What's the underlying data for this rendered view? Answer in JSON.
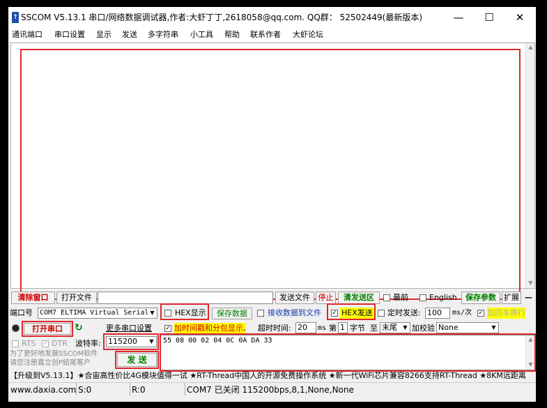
{
  "app": {
    "title": "SSCOM V5.13.1 串口/网络数据调试器,作者:大虾丁丁,2618058@qq.com. QQ群：  52502449(最新版本)",
    "icon": "app-icon",
    "minimize": "—",
    "maximize": "☐",
    "close": "✕"
  },
  "menu": [
    "通讯端口",
    "串口设置",
    "显示",
    "发送",
    "多字符串",
    "小工具",
    "帮助",
    "联系作者",
    "大虾论坛"
  ],
  "receive_area": {
    "content": ""
  },
  "toolbar1": {
    "clear_window": "清除窗口",
    "open_file": "打开文件",
    "file_path": "",
    "send_file": "发送文件",
    "stop": "停止",
    "clear_send_area": "清发送区",
    "topmost_label": "最前",
    "english_label": "English",
    "save_params": "保存参数",
    "expand": "扩展",
    "collapse": "—"
  },
  "port": {
    "label": "端口号",
    "value": "COM7 ELTIMA Virtual Serial",
    "hex_display_label": "HEX显示",
    "save_data": "保存数据",
    "recv_to_file_label": "接收数据到文件",
    "hex_send_label": "HEX发送",
    "timed_send_label": "定时发送:",
    "timed_send_value": "100",
    "timed_send_unit": "ms/次",
    "add_crlf_label": "加回车换行",
    "open_port": "打开串口",
    "more_settings": "更多串口设置",
    "timestamp_label": "加时间戳和分包显示,",
    "timeout_label": "超时时间:",
    "timeout_value": "20",
    "timeout_unit": "ms",
    "byte_prefix": "第",
    "byte_value": "1",
    "byte_unit": "字节",
    "to_label": "至",
    "end_value": "末尾",
    "checksum_label": "加校验",
    "checksum_value": "None",
    "rts_label": "RTS",
    "dtr_label": "DTR",
    "baud_label": "波特率:",
    "baud_value": "115200",
    "send_button": "发 送",
    "hint_line1": "为了更好地发展SSCOM软件",
    "hint_line2": "请您注册嘉立创P结尾客户"
  },
  "send_area": {
    "content": "55 08 00 02 04 0C 0A DA 33"
  },
  "ticker": "【升级到V5.13.1】★合宙高性价比4G模块值得一试 ★RT-Thread中国人的开源免费操作系统 ★新一代WiFi芯片兼容8266支持RT-Thread ★8KM远距离",
  "status": {
    "website": "www.daxia.com",
    "sent": "S:0",
    "received": "R:0",
    "port_status": "COM7 已关闭  115200bps,8,1,None,None"
  },
  "colors": {
    "highlight_red": "#e0282e",
    "green_text": "#008000",
    "yellow_hl": "#ffff00"
  }
}
